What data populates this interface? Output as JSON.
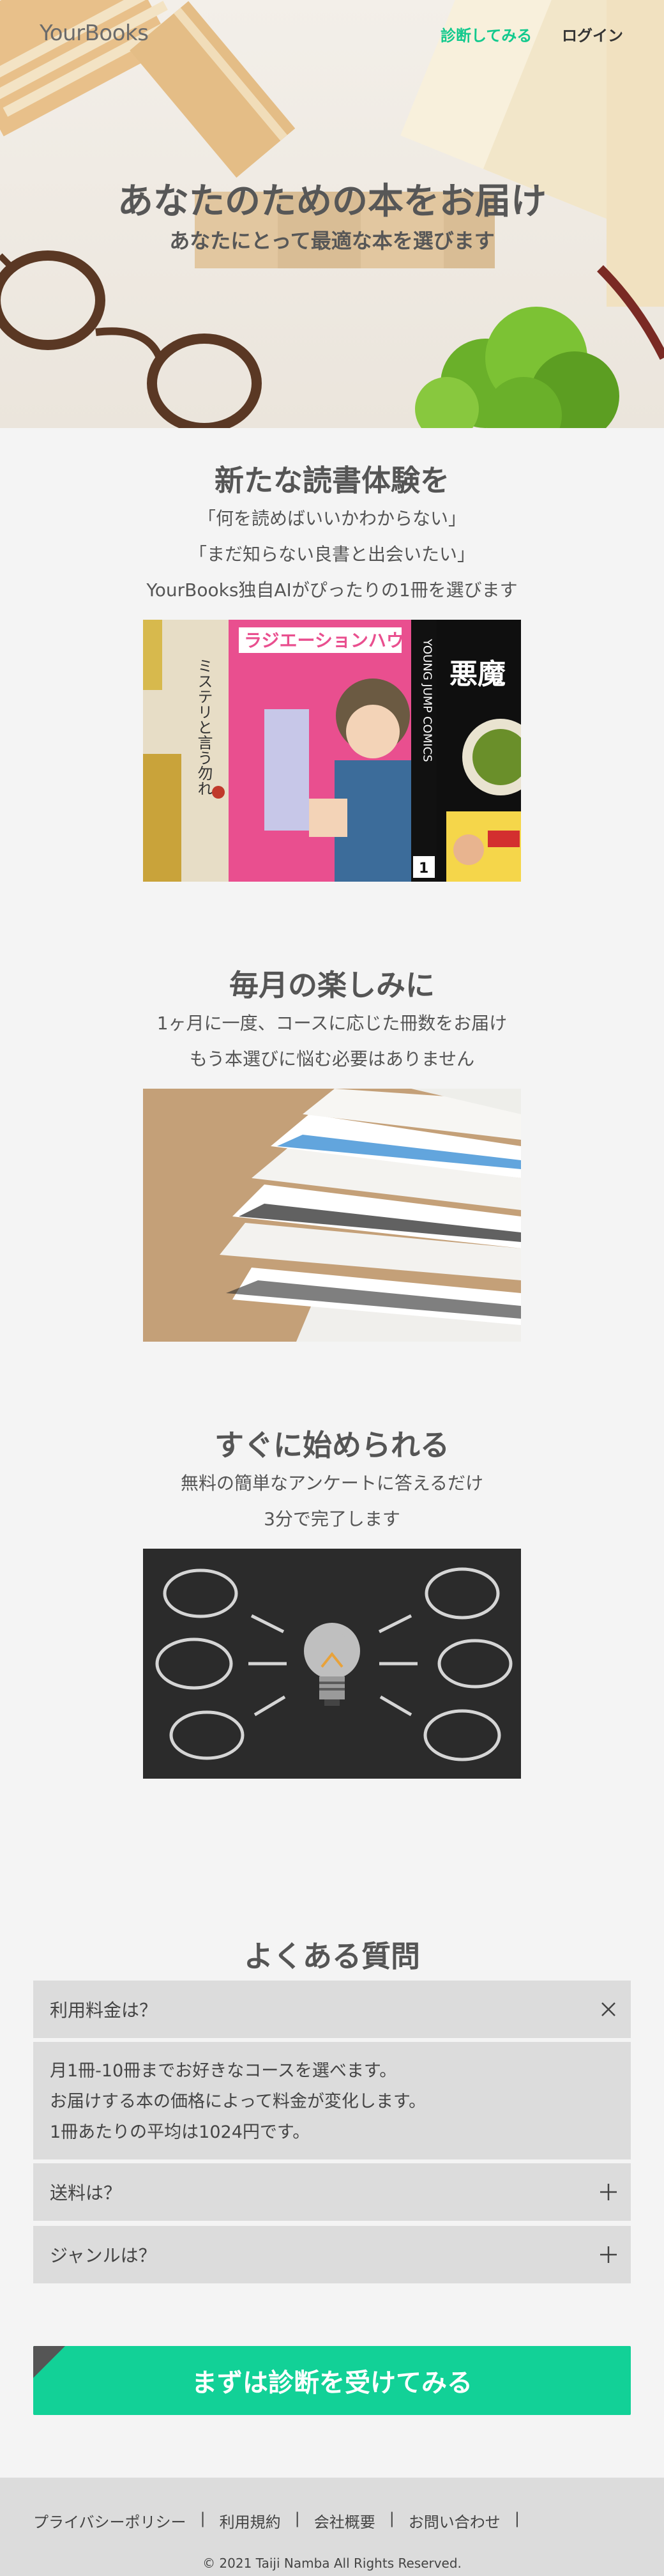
{
  "header": {
    "logo": "YourBooks",
    "nav_diagnose": "診断してみる",
    "nav_login": "ログイン"
  },
  "hero": {
    "title": "あなたのための本をお届け",
    "subtitle": "あなたにとって最適な本を選びます"
  },
  "section1": {
    "title": "新たな読書体験を",
    "lines": [
      "「何を読めばいいかわからない」",
      "「まだ知らない良書と出会いたい」",
      "YourBooks独自AIがぴったりの1冊を選びます"
    ],
    "covers": [
      "ミステリと言う勿れ",
      "ラジエーションハウス",
      "YOUNG JUMP COMICS",
      "悪魔"
    ]
  },
  "section2": {
    "title": "毎月の楽しみに",
    "lines": [
      "1ヶ月に一度、コースに応じた冊数をお届け",
      "もう本選びに悩む必要はありません"
    ]
  },
  "section3": {
    "title": "すぐに始められる",
    "lines": [
      "無料の簡単なアンケートに答えるだけ",
      "3分で完了します"
    ]
  },
  "faq": {
    "title": "よくある質問",
    "items": [
      {
        "q": "利用料金は？",
        "open": true,
        "answer": [
          "月1冊-10冊までお好きなコースを選べます。",
          "お届けする本の価格によって料金が変化します。",
          "1冊あたりの平均は1024円です。"
        ]
      },
      {
        "q": "送料は？",
        "open": false
      },
      {
        "q": "ジャンルは？",
        "open": false
      }
    ]
  },
  "cta": {
    "label": "まずは診断を受けてみる"
  },
  "footer": {
    "links": [
      "プライバシーポリシー",
      "利用規約",
      "会社概要",
      "お問い合わせ"
    ],
    "separator": "|",
    "copyright": "© 2021 Taiji Namba All Rights Reserved."
  },
  "colors": {
    "accent": "#12d197",
    "nav_accent": "#12c98d",
    "faq_bg": "#dcdcdc",
    "page_bg": "#f4f4f4"
  }
}
